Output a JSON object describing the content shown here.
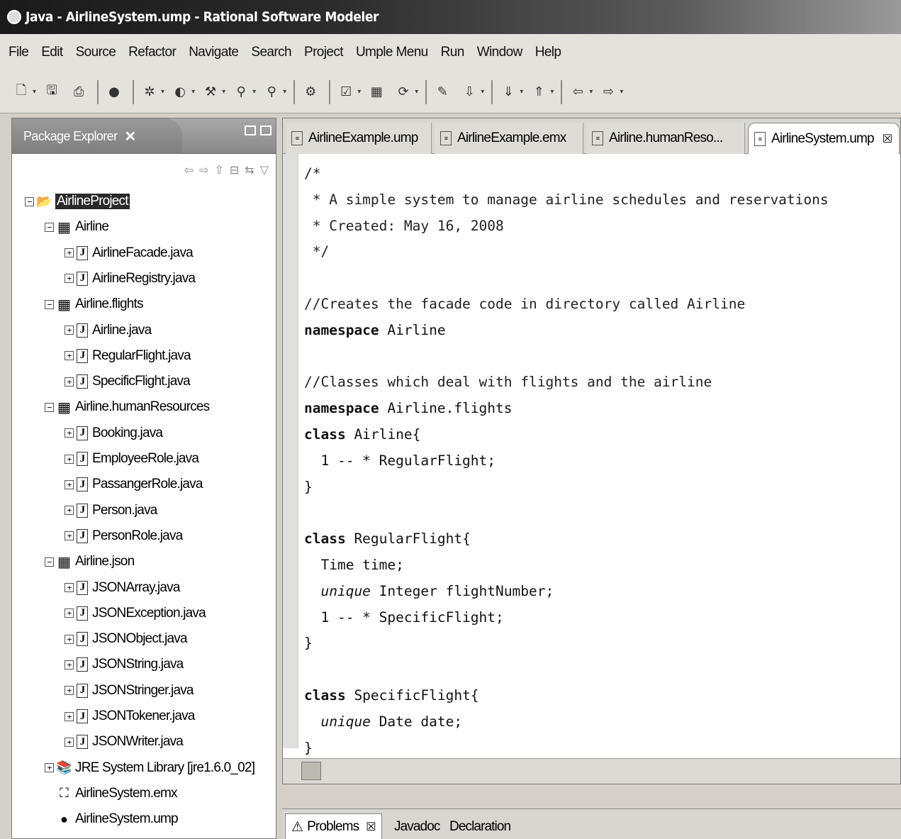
{
  "window": {
    "title": "Java - AirlineSystem.ump - Rational Software Modeler"
  },
  "menubar": {
    "items": [
      {
        "label": "File"
      },
      {
        "label": "Edit"
      },
      {
        "label": "Source"
      },
      {
        "label": "Refactor"
      },
      {
        "label": "Navigate"
      },
      {
        "label": "Search"
      },
      {
        "label": "Project"
      },
      {
        "label": "Umple Menu"
      },
      {
        "label": "Run"
      },
      {
        "label": "Window"
      },
      {
        "label": "Help"
      }
    ]
  },
  "toolbar": {
    "icons": [
      "new-icon",
      "save-icon",
      "print-icon",
      "record-icon",
      "debug-icon",
      "run-icon",
      "external-tools-icon",
      "search-icon",
      "search-reference-icon",
      "open-type-icon",
      "open-task-icon",
      "package-icon",
      "refresh-icon",
      "edit-icon",
      "annotation-icon",
      "next-annotation-icon",
      "prev-annotation-icon",
      "back-icon",
      "forward-icon"
    ]
  },
  "package_explorer": {
    "tab_label": "Package Explorer",
    "tree": [
      {
        "label": "AirlineProject",
        "type": "project",
        "level": 0,
        "expander": "−",
        "selected": true
      },
      {
        "label": "Airline",
        "type": "package",
        "level": 1,
        "expander": "−"
      },
      {
        "label": "AirlineFacade.java",
        "type": "java",
        "level": 2,
        "expander": "+"
      },
      {
        "label": "AirlineRegistry.java",
        "type": "java",
        "level": 2,
        "expander": "+"
      },
      {
        "label": "Airline.flights",
        "type": "package",
        "level": 1,
        "expander": "−"
      },
      {
        "label": "Airline.java",
        "type": "java",
        "level": 2,
        "expander": "+"
      },
      {
        "label": "RegularFlight.java",
        "type": "java",
        "level": 2,
        "expander": "+"
      },
      {
        "label": "SpecificFlight.java",
        "type": "java",
        "level": 2,
        "expander": "+"
      },
      {
        "label": "Airline.humanResources",
        "type": "package",
        "level": 1,
        "expander": "−"
      },
      {
        "label": "Booking.java",
        "type": "java",
        "level": 2,
        "expander": "+"
      },
      {
        "label": "EmployeeRole.java",
        "type": "java",
        "level": 2,
        "expander": "+"
      },
      {
        "label": "PassangerRole.java",
        "type": "java",
        "level": 2,
        "expander": "+"
      },
      {
        "label": "Person.java",
        "type": "java",
        "level": 2,
        "expander": "+"
      },
      {
        "label": "PersonRole.java",
        "type": "java",
        "level": 2,
        "expander": "+"
      },
      {
        "label": "Airline.json",
        "type": "package",
        "level": 1,
        "expander": "−"
      },
      {
        "label": "JSONArray.java",
        "type": "java",
        "level": 2,
        "expander": "+"
      },
      {
        "label": "JSONException.java",
        "type": "java",
        "level": 2,
        "expander": "+"
      },
      {
        "label": "JSONObject.java",
        "type": "java",
        "level": 2,
        "expander": "+"
      },
      {
        "label": "JSONString.java",
        "type": "java",
        "level": 2,
        "expander": "+"
      },
      {
        "label": "JSONStringer.java",
        "type": "java",
        "level": 2,
        "expander": "+"
      },
      {
        "label": "JSONTokener.java",
        "type": "java",
        "level": 2,
        "expander": "+"
      },
      {
        "label": "JSONWriter.java",
        "type": "java",
        "level": 2,
        "expander": "+"
      },
      {
        "label": "JRE System Library [jre1.6.0_02]",
        "type": "library",
        "level": 1,
        "expander": "+"
      },
      {
        "label": "AirlineSystem.emx",
        "type": "emx",
        "level": 1,
        "expander": ""
      },
      {
        "label": "AirlineSystem.ump",
        "type": "ump",
        "level": 1,
        "expander": ""
      }
    ]
  },
  "editor": {
    "tabs": [
      {
        "label": "AirlineExample.ump",
        "active": false
      },
      {
        "label": "AirlineExample.emx",
        "active": false
      },
      {
        "label": "Airline.humanReso...",
        "active": false
      },
      {
        "label": "AirlineSystem.ump",
        "active": true
      }
    ],
    "close_glyph": "☒",
    "code_lines": [
      [
        {
          "t": "/*",
          "c": "comment"
        }
      ],
      [
        {
          "t": " * A simple system to manage airline schedules and reservations",
          "c": "comment"
        }
      ],
      [
        {
          "t": " * Created: May 16, 2008",
          "c": "comment"
        }
      ],
      [
        {
          "t": " */",
          "c": "comment"
        }
      ],
      [
        {
          "t": "",
          "c": ""
        }
      ],
      [
        {
          "t": "//Creates the facade code in directory called Airline",
          "c": "comment"
        }
      ],
      [
        {
          "t": "namespace",
          "c": "kw"
        },
        {
          "t": " Airline",
          "c": ""
        }
      ],
      [
        {
          "t": "",
          "c": ""
        }
      ],
      [
        {
          "t": "//Classes which deal with flights and the airline",
          "c": "comment"
        }
      ],
      [
        {
          "t": "namespace",
          "c": "kw"
        },
        {
          "t": " Airline.flights",
          "c": ""
        }
      ],
      [
        {
          "t": "class",
          "c": "kw"
        },
        {
          "t": " Airline{",
          "c": ""
        }
      ],
      [
        {
          "t": "  1 -- * RegularFlight;",
          "c": ""
        }
      ],
      [
        {
          "t": "}",
          "c": ""
        }
      ],
      [
        {
          "t": "",
          "c": ""
        }
      ],
      [
        {
          "t": "class",
          "c": "kw"
        },
        {
          "t": " RegularFlight{",
          "c": ""
        }
      ],
      [
        {
          "t": "  Time time;",
          "c": ""
        }
      ],
      [
        {
          "t": "  ",
          "c": ""
        },
        {
          "t": "unique",
          "c": "it"
        },
        {
          "t": " Integer flightNumber;",
          "c": ""
        }
      ],
      [
        {
          "t": "  1 -- * SpecificFlight;",
          "c": ""
        }
      ],
      [
        {
          "t": "}",
          "c": ""
        }
      ],
      [
        {
          "t": "",
          "c": ""
        }
      ],
      [
        {
          "t": "class",
          "c": "kw"
        },
        {
          "t": " SpecificFlight{",
          "c": ""
        }
      ],
      [
        {
          "t": "  ",
          "c": ""
        },
        {
          "t": "unique",
          "c": "it"
        },
        {
          "t": " Date date;",
          "c": ""
        }
      ],
      [
        {
          "t": "}",
          "c": ""
        }
      ]
    ]
  },
  "bottom_views": {
    "tabs": [
      {
        "label": "Problems",
        "active": true
      },
      {
        "label": "Javadoc",
        "active": false
      },
      {
        "label": "Declaration",
        "active": false
      }
    ]
  }
}
